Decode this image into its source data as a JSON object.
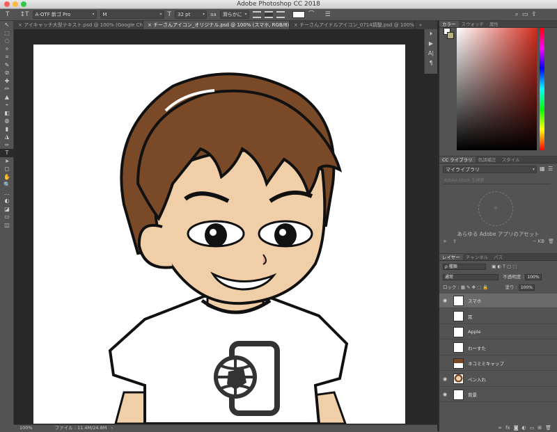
{
  "window": {
    "title": "Adobe Photoshop CC 2018"
  },
  "options_bar": {
    "tool_icon": "T",
    "orientation_icon": "↕T",
    "font_family": "A-OTF 新ゴ Pro",
    "font_style": "M",
    "size_icon": "T",
    "font_size": "32 pt",
    "aa_icon": "aa",
    "antialias": "滑らかに"
  },
  "tabs": [
    {
      "label": "× アイキャッチ大型テキスト.psd @ 100% (Google Chro..."
    },
    {
      "label": "× チーさんアイコン_オリジナル.psd @ 100% (スマホ, RGB/8) *"
    },
    {
      "label": "× チーさんアイドルアイコン_0714調整.psd @ 100% (ロ..."
    }
  ],
  "tools": [
    "↖",
    "⬚",
    "◌",
    "✧",
    "⌗",
    "✎",
    "⊘",
    "✚",
    "✏",
    "▲",
    "⌁",
    "◧",
    "◍",
    "▮",
    "◮",
    "✑",
    "T",
    "➤",
    "◻",
    "✋",
    "🔍",
    "…",
    "◐",
    "◪",
    "▭",
    "◫"
  ],
  "status": {
    "zoom": "100%",
    "file_info": "ファイル : 11.4M/24.8M"
  },
  "side_strip": [
    "⏵",
    "▶",
    "A|",
    "¶"
  ],
  "color_panel": {
    "tabs": [
      "カラー",
      "スウォッチ",
      "属性"
    ]
  },
  "library_panel": {
    "tabs": [
      "CC ライブラリ",
      "色調補正",
      "スタイル"
    ],
    "selected_library": "マイライブラリ",
    "search_placeholder": "Adobe Stock を検索",
    "plus": "+",
    "empty_text": "あらゆる Adobe アプリのアセット",
    "size_text": "-- KB"
  },
  "layers_panel": {
    "tabs": [
      "レイヤー",
      "チャンネル",
      "パス"
    ],
    "kind_filter": "ρ 種類",
    "blend_mode": "通常",
    "opacity_label": "不透明度 :",
    "opacity_value": "100%",
    "lock_label": "ロック :",
    "fill_label": "塗り :",
    "fill_value": "100%",
    "layers": [
      {
        "name": "スマホ",
        "visible": true,
        "selected": true
      },
      {
        "name": "耳",
        "visible": false,
        "selected": false
      },
      {
        "name": "Apple",
        "visible": false,
        "selected": false
      },
      {
        "name": "わーすた",
        "visible": false,
        "selected": false
      },
      {
        "name": "ネコミミキャップ",
        "visible": false,
        "selected": false
      },
      {
        "name": "ペン入れ",
        "visible": true,
        "selected": false
      },
      {
        "name": "背景",
        "visible": true,
        "selected": false
      }
    ]
  },
  "colors": {
    "hair": "#7a4a28",
    "skin": "#f0cfa8",
    "shirt": "#ffffff",
    "ink": "#111111",
    "accent_red": "#d22d1f"
  }
}
